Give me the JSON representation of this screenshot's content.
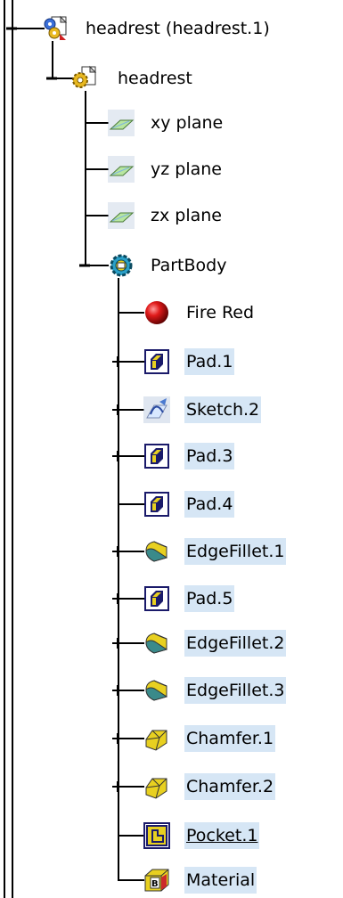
{
  "tree": {
    "root": {
      "label": "headrest (headrest.1)",
      "icon": "product-icon",
      "expander": "minus"
    },
    "part": {
      "label": "headrest",
      "icon": "part-icon",
      "expander": "minus"
    },
    "planes": [
      {
        "label": "xy plane",
        "icon": "plane-icon"
      },
      {
        "label": "yz plane",
        "icon": "plane-icon"
      },
      {
        "label": "zx plane",
        "icon": "plane-icon"
      }
    ],
    "body": {
      "label": "PartBody",
      "icon": "partbody-icon",
      "expander": "minus"
    },
    "features": [
      {
        "label": "Fire Red",
        "icon": "material-sphere-icon",
        "expander": "none",
        "highlight": false
      },
      {
        "label": "Pad.1",
        "icon": "pad-icon",
        "expander": "plus",
        "highlight": true
      },
      {
        "label": "Sketch.2",
        "icon": "sketch-icon",
        "expander": "plus",
        "highlight": true
      },
      {
        "label": "Pad.3",
        "icon": "pad-icon",
        "expander": "plus",
        "highlight": true
      },
      {
        "label": "Pad.4",
        "icon": "pad-icon",
        "expander": "none",
        "highlight": true
      },
      {
        "label": "EdgeFillet.1",
        "icon": "edgefillet-icon",
        "expander": "plus",
        "highlight": true
      },
      {
        "label": "Pad.5",
        "icon": "pad-icon",
        "expander": "plus",
        "highlight": true
      },
      {
        "label": "EdgeFillet.2",
        "icon": "edgefillet-icon",
        "expander": "plus",
        "highlight": true
      },
      {
        "label": "EdgeFillet.3",
        "icon": "edgefillet-icon",
        "expander": "plus",
        "highlight": true
      },
      {
        "label": "Chamfer.1",
        "icon": "chamfer-icon",
        "expander": "plus",
        "highlight": true
      },
      {
        "label": "Chamfer.2",
        "icon": "chamfer-icon",
        "expander": "plus",
        "highlight": true
      },
      {
        "label": "Pocket.1",
        "icon": "pocket-icon",
        "expander": "none",
        "highlight": true,
        "underline": true
      },
      {
        "label": "Material",
        "icon": "material-icon",
        "expander": "none",
        "highlight": true
      }
    ]
  },
  "colors": {
    "highlight": "#d6e6f5",
    "line": "#000000"
  }
}
